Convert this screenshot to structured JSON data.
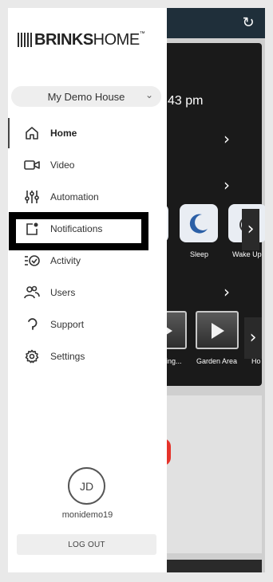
{
  "app": {
    "brand_bold": "BRINKS",
    "brand_thin": "HOME",
    "brand_mark": "™"
  },
  "house_selector": {
    "value": "My Demo House",
    "icon": "chevron-down-icon"
  },
  "nav": {
    "items": [
      {
        "label": "Home",
        "icon": "home-icon",
        "active": true
      },
      {
        "label": "Video",
        "icon": "video-camera-icon"
      },
      {
        "label": "Automation",
        "icon": "sliders-icon"
      },
      {
        "label": "Notifications",
        "icon": "notification-icon"
      },
      {
        "label": "Activity",
        "icon": "activity-list-icon"
      },
      {
        "label": "Users",
        "icon": "users-icon"
      },
      {
        "label": "Support",
        "icon": "support-icon"
      },
      {
        "label": "Settings",
        "icon": "gear-icon"
      }
    ]
  },
  "user": {
    "initials": "JD",
    "username": "monidemo19",
    "logout_label": "LOG OUT"
  },
  "background": {
    "time_fragment": "43 pm",
    "scene_tiles": [
      "Sleep",
      "Wake Up"
    ],
    "video_tiles": [
      "ning...",
      "Garden Area",
      "Ho"
    ]
  },
  "colors": {
    "highlight_border": "#000000",
    "topbar": "#1f2f3a",
    "dark_card": "#1a1a1a",
    "accent_red": "#e5332a"
  }
}
